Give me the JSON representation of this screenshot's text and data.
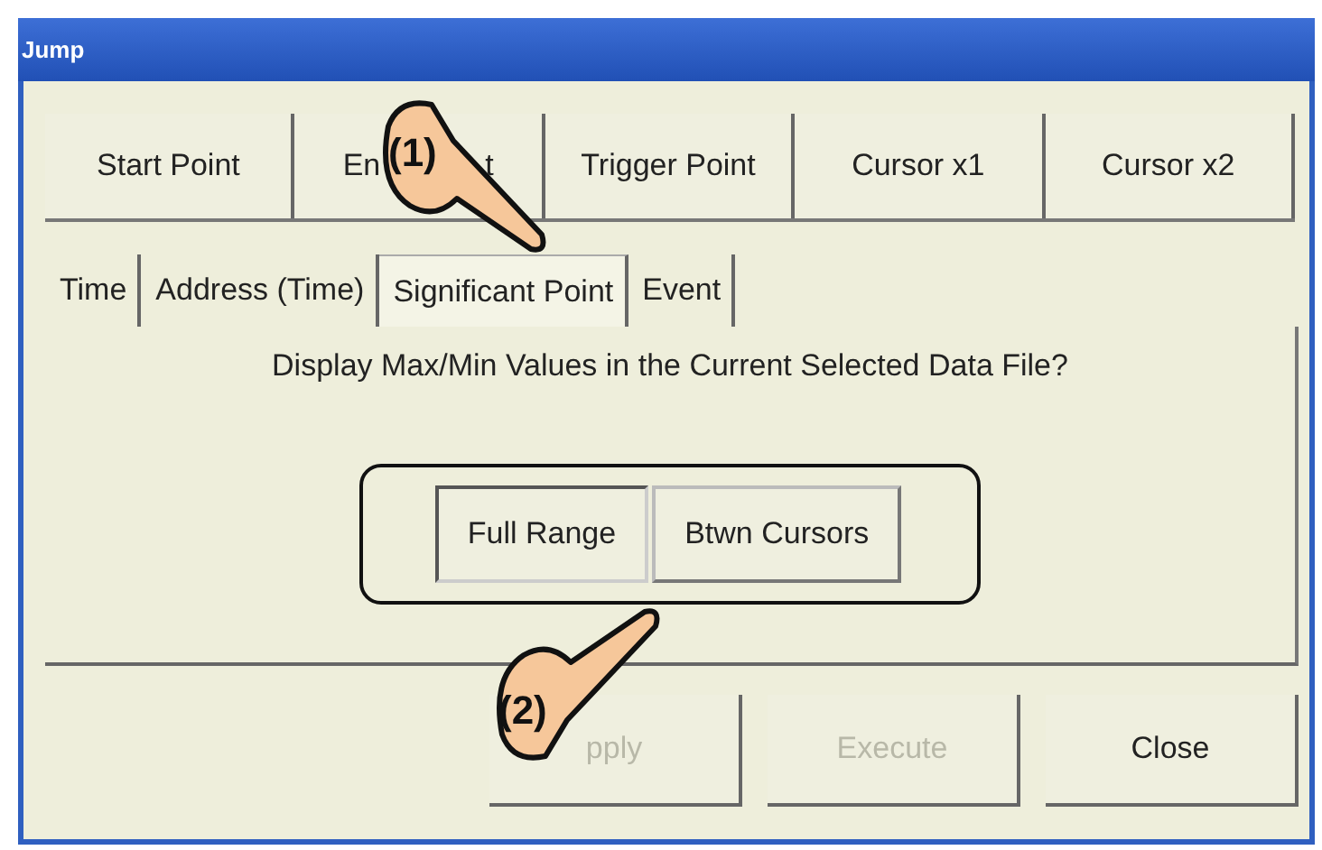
{
  "window": {
    "title": "Jump"
  },
  "jump_buttons": [
    {
      "label_parts": [
        "Start Point"
      ]
    },
    {
      "label_parts": [
        "En",
        "t"
      ]
    },
    {
      "label_parts": [
        "Trigger Point"
      ]
    },
    {
      "label_parts": [
        "Cursor x1"
      ]
    },
    {
      "label_parts": [
        "Cursor x2"
      ]
    }
  ],
  "tabs": [
    {
      "label": "Time",
      "selected": false
    },
    {
      "label": "Address (Time)",
      "selected": false
    },
    {
      "label": "Significant Point",
      "selected": true
    },
    {
      "label": "Event",
      "selected": false
    }
  ],
  "prompt": "Display Max/Min Values in the Current Selected Data File?",
  "range_options": [
    {
      "label": "Full Range",
      "selected": true
    },
    {
      "label": "Btwn Cursors",
      "selected": false
    }
  ],
  "actions": [
    {
      "label": "pply",
      "disabled": true
    },
    {
      "label": "Execute",
      "disabled": true
    },
    {
      "label": "Close",
      "disabled": false
    }
  ],
  "callouts": [
    {
      "number": "(1)"
    },
    {
      "number": "(2)"
    }
  ]
}
